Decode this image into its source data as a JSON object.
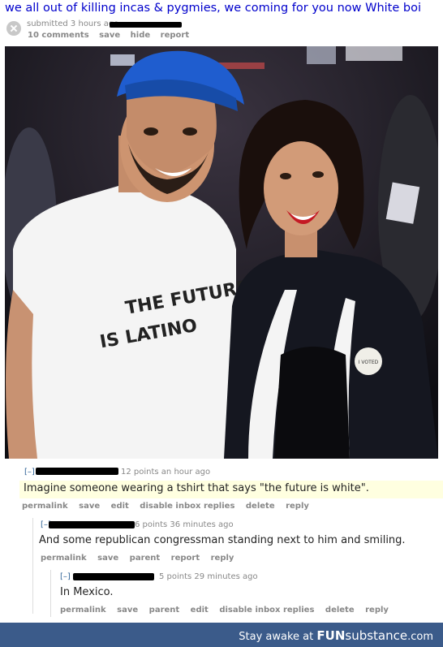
{
  "post": {
    "title": "we all out of killing incas & pygmies, we coming for you now White boi",
    "submitted": "submitted 3 hours ago",
    "actions": [
      "10 comments",
      "save",
      "hide",
      "report"
    ]
  },
  "image": {
    "shirt_text_line1": "THE FUTURE",
    "shirt_text_line2": "IS LATINO",
    "button_text": "I VOTED"
  },
  "comments": [
    {
      "toggle": "[–]",
      "meta": "12 points an hour ago",
      "body": "Imagine someone wearing a tshirt that says \"the future is white\".",
      "actions": [
        "permalink",
        "save",
        "edit",
        "disable inbox replies",
        "delete",
        "reply"
      ]
    },
    {
      "toggle": "[–]",
      "meta": "6 points 36 minutes ago",
      "body": "And some republican congressman standing next to him and smiling.",
      "actions": [
        "permalink",
        "save",
        "parent",
        "report",
        "reply"
      ]
    },
    {
      "toggle": "[–]",
      "meta": "5 points 29 minutes ago",
      "body": "In Mexico.",
      "actions": [
        "permalink",
        "save",
        "parent",
        "edit",
        "disable inbox replies",
        "delete",
        "reply"
      ]
    }
  ],
  "footer": {
    "prefix": "Stay awake at ",
    "brand_a": "FUN",
    "brand_b": "substance",
    "brand_c": ".com"
  },
  "colors": {
    "link": "#0000cc",
    "highlight": "#ffffe0",
    "footer_bg": "#3b5b8a"
  }
}
